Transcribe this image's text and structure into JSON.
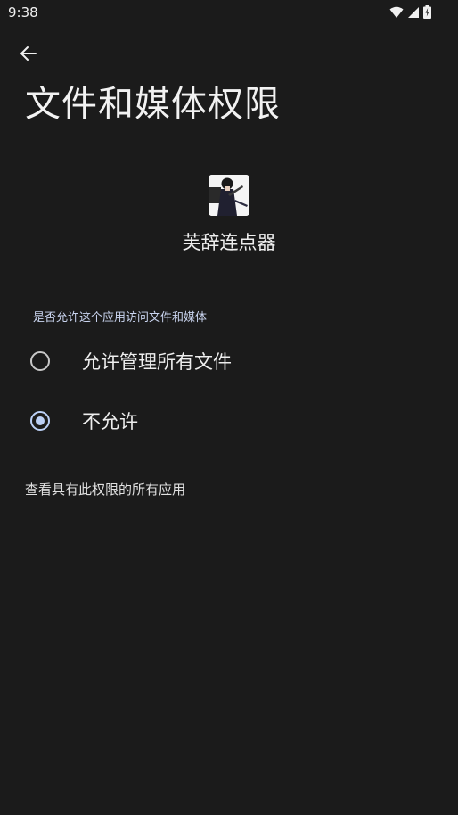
{
  "status_bar": {
    "time": "9:38",
    "icons": [
      "wifi-icon",
      "cellular-signal-icon",
      "battery-charging-icon"
    ]
  },
  "header": {
    "back_icon": "arrow-back-icon",
    "title": "文件和媒体权限"
  },
  "app": {
    "name": "芙辞连点器"
  },
  "permission": {
    "question": "是否允许这个应用访问文件和媒体",
    "options": [
      {
        "label": "允许管理所有文件",
        "selected": false
      },
      {
        "label": "不允许",
        "selected": true
      }
    ]
  },
  "footer": {
    "link": "查看具有此权限的所有应用"
  },
  "colors": {
    "background": "#1b1b1b",
    "accent": "#bcd0f5",
    "text": "#eeeeee"
  }
}
